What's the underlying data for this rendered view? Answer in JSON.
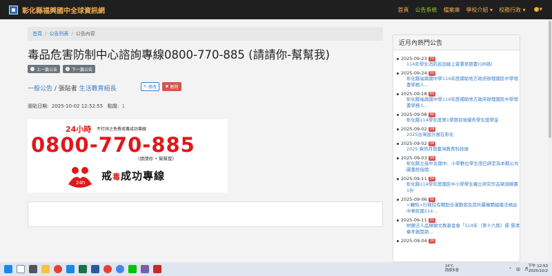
{
  "navbar": {
    "title": "彰化縣福興國中全球資訊網",
    "links": [
      "首頁",
      "公告系統",
      "檔案庫",
      "學校介紹 ▾",
      "校務行政 ▾"
    ],
    "user_icon": "user-icon",
    "colors": {
      "bg": "#1f1f1f",
      "link": "#f0ad4e",
      "active": "#9acd32"
    }
  },
  "breadcrumb": [
    "首頁",
    "公告列表",
    "公告內容"
  ],
  "post": {
    "title": "毒品危害防制中心諮詢專線0800-770-885 (請請你-幫幫我)",
    "prev_label": "上一篇公告",
    "next_label": "下一篇公告",
    "category": "一般公告",
    "poster_prefix": " / 張貼者 ",
    "poster": "生活教育組長",
    "edit_label": "修改",
    "delete_label": "刪除",
    "date_label": "張貼日期:",
    "date": "2025-10-02 12:52:55",
    "clicks_label": "點閱:",
    "clicks": "1"
  },
  "banner": {
    "top_red": "24小時",
    "top_text": "不打烊之免費戒毒成功專線",
    "phone": "0800-770-885",
    "sub": "(請請你 • 幫幫我)",
    "logo_text": "24h",
    "slogan_a": "戒",
    "slogan_b": "毒",
    "slogan_c": "成功專線"
  },
  "sidebar": {
    "heading": "近月內熱門公告",
    "items": [
      {
        "date": "2025-09-23",
        "count": "70",
        "title": "114年學生消防巡迴線上簽署參期書(QR碼)"
      },
      {
        "date": "2025-09-24",
        "count": "50",
        "title": "彰化縣福興國中學114年度補助地方政府辦理國民中學增書學務人..."
      },
      {
        "date": "2025-09-18",
        "count": "45",
        "title": "彰化縣福興國中學114年度補助地方政府辦理國民中學增書學務人..."
      },
      {
        "date": "2025-09-08",
        "count": "40",
        "title": "彰化縣114學年度第1學期自強優秀學生獎學金"
      },
      {
        "date": "2025-09-02",
        "count": "39",
        "title": "2025台灣設計展在彰化"
      },
      {
        "date": "2025-09-02",
        "count": "34",
        "title": "2025 資訊月暨臺灣教育科技展"
      },
      {
        "date": "2025-09-03",
        "count": "34",
        "title": "彰化縣立高中及國中、小學數位學生證已綁定為本縣公共圖書館借閱..."
      },
      {
        "date": "2025-09-11",
        "count": "34",
        "title": "彰化縣114學年度國民中小學學生獨立研究作品徵調競賽1份"
      },
      {
        "date": "2025-09-06",
        "count": "31",
        "title": "<轉知>行政院有關配合運動部及其所屬機關組織法規由中華民國114..."
      },
      {
        "date": "2025-09-11",
        "count": "31",
        "title": "財團法人品顏徵文教基金會「114年（第十六屆）儒 儒清秦孝親獎助..."
      },
      {
        "date": "2025-09-04",
        "count": "30",
        "title": ""
      }
    ]
  },
  "taskbar": {
    "weather_temp": "24°C",
    "weather_desc": "局部多雲",
    "lang": "中",
    "time": "下午 12:53",
    "date": "2025/10/2"
  }
}
